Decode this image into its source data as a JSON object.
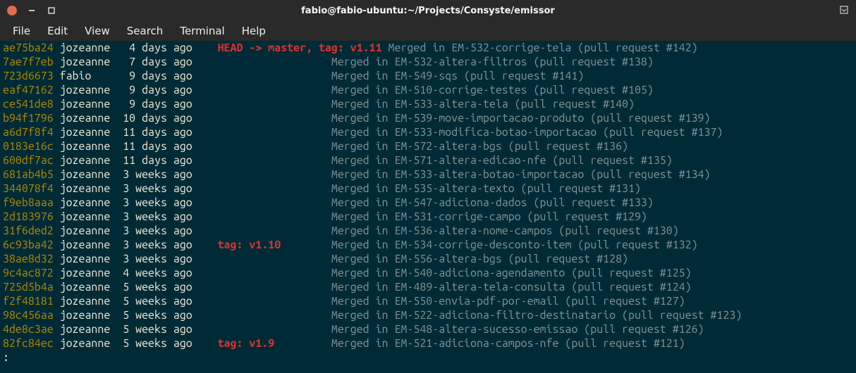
{
  "window": {
    "title": "fabio@fabio-ubuntu:~/Projects/Consyste/emissor"
  },
  "menubar": {
    "file": "File",
    "edit": "Edit",
    "view": "View",
    "search": "Search",
    "terminal": "Terminal",
    "help": "Help"
  },
  "prompt": ":",
  "log": [
    {
      "hash": "ae75ba24",
      "author": "jozeanne",
      "age": "4 days ago",
      "ref": "HEAD -> master, tag: v1.11",
      "msg": " Merged in EM-532-corrige-tela (pull request #142)"
    },
    {
      "hash": "7ae7f7eb",
      "author": "jozeanne",
      "age": "7 days ago",
      "ref": "",
      "msg": "Merged in EM-532-altera-filtros (pull request #138)"
    },
    {
      "hash": "723d6673",
      "author": "fabio",
      "age": "9 days ago",
      "ref": "",
      "msg": "Merged in EM-549-sqs (pull request #141)"
    },
    {
      "hash": "eaf47162",
      "author": "jozeanne",
      "age": "9 days ago",
      "ref": "",
      "msg": "Merged in EM-510-corrige-testes (pull request #105)"
    },
    {
      "hash": "ce541de8",
      "author": "jozeanne",
      "age": "9 days ago",
      "ref": "",
      "msg": "Merged in EM-533-altera-tela (pull request #140)"
    },
    {
      "hash": "b94f1796",
      "author": "jozeanne",
      "age": "10 days ago",
      "ref": "",
      "msg": "Merged in EM-539-move-importacao-produto (pull request #139)"
    },
    {
      "hash": "a6d7f8f4",
      "author": "jozeanne",
      "age": "11 days ago",
      "ref": "",
      "msg": "Merged in EM-533-modifica-botao-importacao (pull request #137)"
    },
    {
      "hash": "0183e16c",
      "author": "jozeanne",
      "age": "11 days ago",
      "ref": "",
      "msg": "Merged in EM-572-altera-bgs (pull request #136)"
    },
    {
      "hash": "600df7ac",
      "author": "jozeanne",
      "age": "11 days ago",
      "ref": "",
      "msg": "Merged in EM-571-altera-edicao-nfe (pull request #135)"
    },
    {
      "hash": "681ab4b5",
      "author": "jozeanne",
      "age": "3 weeks ago",
      "ref": "",
      "msg": "Merged in EM-533-altera-botao-importacao (pull request #134)"
    },
    {
      "hash": "344078f4",
      "author": "jozeanne",
      "age": "3 weeks ago",
      "ref": "",
      "msg": "Merged in EM-535-altera-texto (pull request #131)"
    },
    {
      "hash": "f9eb8aaa",
      "author": "jozeanne",
      "age": "3 weeks ago",
      "ref": "",
      "msg": "Merged in EM-547-adiciona-dados (pull request #133)"
    },
    {
      "hash": "2d183976",
      "author": "jozeanne",
      "age": "3 weeks ago",
      "ref": "",
      "msg": "Merged in EM-531-corrige-campo (pull request #129)"
    },
    {
      "hash": "31f6ded2",
      "author": "jozeanne",
      "age": "3 weeks ago",
      "ref": "",
      "msg": "Merged in EM-536-altera-nome-campos (pull request #130)"
    },
    {
      "hash": "6c93ba42",
      "author": "jozeanne",
      "age": "3 weeks ago",
      "ref": "tag: v1.10",
      "msg": "        Merged in EM-534-corrige-desconto-item (pull request #132)"
    },
    {
      "hash": "38ae8d32",
      "author": "jozeanne",
      "age": "3 weeks ago",
      "ref": "",
      "msg": "Merged in EM-556-altera-bgs (pull request #128)"
    },
    {
      "hash": "9c4ac872",
      "author": "jozeanne",
      "age": "4 weeks ago",
      "ref": "",
      "msg": "Merged in EM-540-adiciona-agendamento (pull request #125)"
    },
    {
      "hash": "725d5b4a",
      "author": "jozeanne",
      "age": "5 weeks ago",
      "ref": "",
      "msg": "Merged in EM-489-altera-tela-consulta (pull request #124)"
    },
    {
      "hash": "f2f48181",
      "author": "jozeanne",
      "age": "5 weeks ago",
      "ref": "",
      "msg": "Merged in EM-550-envia-pdf-por-email (pull request #127)"
    },
    {
      "hash": "98c456aa",
      "author": "jozeanne",
      "age": "5 weeks ago",
      "ref": "",
      "msg": "Merged in EM-522-adiciona-filtro-destinatario (pull request #123)"
    },
    {
      "hash": "4de8c3ae",
      "author": "jozeanne",
      "age": "5 weeks ago",
      "ref": "",
      "msg": "Merged in EM-548-altera-sucesso-emissao (pull request #126)"
    },
    {
      "hash": "82fc84ec",
      "author": "jozeanne",
      "age": "5 weeks ago",
      "ref": "tag: v1.9",
      "msg": "         Merged in EM-521-adiciona-campos-nfe (pull request #121)"
    }
  ]
}
